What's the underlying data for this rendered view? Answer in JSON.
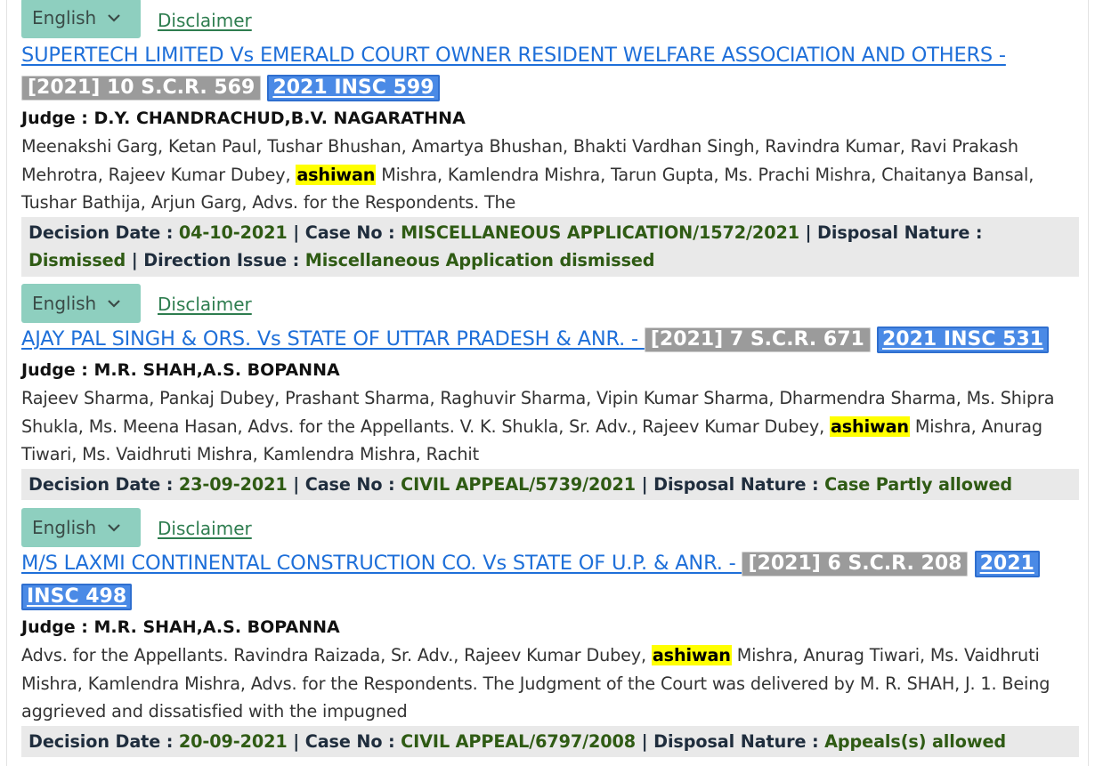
{
  "common": {
    "language_label": "English",
    "disclaimer_label": "Disclaimer",
    "judge_label": "Judge : ",
    "decision_date_label": "Decision Date : ",
    "case_no_label": "Case No : ",
    "disposal_label": "Disposal Nature : ",
    "direction_label": "Direction Issue : ",
    "sep": " | "
  },
  "results": [
    {
      "title": "SUPERTECH LIMITED Vs EMERALD COURT OWNER RESIDENT WELFARE ASSOCIATION AND OTHERS - ",
      "scr": "[2021] 10 S.C.R. 569",
      "insc": "2021 INSC 599",
      "judges": "D.Y. CHANDRACHUD,B.V. NAGARATHNA",
      "snippet_before": "Meenakshi Garg, Ketan Paul, Tushar Bhushan, Amartya Bhushan, Bhakti Vardhan Singh, Ravindra Kumar, Ravi Prakash Mehrotra, Rajeev Kumar Dubey, ",
      "highlight": "ashiwan",
      "snippet_after": " Mishra, Kamlendra Mishra, Tarun Gupta, Ms. Prachi Mishra, Chaitanya Bansal, Tushar Bathija, Arjun Garg, Advs. for the Respondents. The",
      "decision_date": "04-10-2021",
      "case_no": "MISCELLANEOUS APPLICATION/1572/2021",
      "disposal": "Dismissed",
      "direction": "Miscellaneous Application dismissed"
    },
    {
      "title": "AJAY PAL SINGH & ORS. Vs STATE OF UTTAR PRADESH & ANR. - ",
      "scr": "[2021] 7 S.C.R. 671",
      "insc": "2021 INSC 531",
      "judges": "M.R. SHAH,A.S. BOPANNA",
      "snippet_before": "Rajeev Sharma, Pankaj Dubey, Prashant Sharma, Raghuvir Sharma, Vipin Kumar Sharma, Dharmendra Sharma, Ms. Shipra Shukla, Ms. Meena Hasan, Advs. for the Appellants. V. K. Shukla, Sr. Adv., Rajeev Kumar Dubey, ",
      "highlight": "ashiwan",
      "snippet_after": " Mishra, Anurag Tiwari, Ms. Vaidhruti Mishra, Kamlendra Mishra, Rachit",
      "decision_date": "23-09-2021",
      "case_no": "CIVIL APPEAL/5739/2021",
      "disposal": "Case Partly allowed"
    },
    {
      "title": "M/S LAXMI CONTINENTAL CONSTRUCTION CO. Vs STATE OF U.P. & ANR. - ",
      "scr": "[2021] 6 S.C.R. 208",
      "insc": "2021 INSC 498",
      "judges": "M.R. SHAH,A.S. BOPANNA",
      "snippet_before": "Advs. for the Appellants. Ravindra Raizada, Sr. Adv., Rajeev Kumar Dubey, ",
      "highlight": "ashiwan",
      "snippet_after": " Mishra, Anurag Tiwari, Ms. Vaidhruti Mishra, Kamlendra Mishra, Advs. for the Respondents. The Judgment of the Court was delivered by M. R. SHAH, J. 1. Being aggrieved and dissatisfied with the impugned",
      "decision_date": "20-09-2021",
      "case_no": "CIVIL APPEAL/6797/2008",
      "disposal": "Appeals(s) allowed"
    }
  ]
}
